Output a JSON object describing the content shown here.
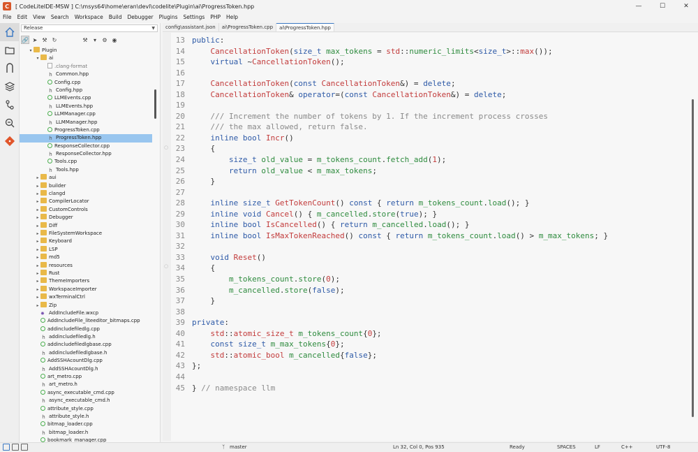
{
  "window": {
    "title": "[ CodeLiteIDE-MSW ] C:\\msys64\\home\\eran\\devl\\codelite\\Plugin\\ai\\ProgressToken.hpp",
    "app_icon_letter": "C",
    "controls": [
      "—",
      "☐",
      "✕"
    ]
  },
  "menu": [
    "File",
    "Edit",
    "View",
    "Search",
    "Workspace",
    "Build",
    "Debugger",
    "Plugins",
    "Settings",
    "PHP",
    "Help"
  ],
  "activity_bar": [
    "home-icon",
    "folder-icon",
    "magnet-icon",
    "layers-icon",
    "source-control-icon",
    "search-icon",
    "git-icon"
  ],
  "sidebar": {
    "config": "Release",
    "tree": [
      {
        "label": "Plugin",
        "type": "folder",
        "depth": 1,
        "open": true
      },
      {
        "label": "ai",
        "type": "folder",
        "depth": 2,
        "open": true
      },
      {
        "label": ".clang-format",
        "type": "file",
        "depth": 3,
        "dim": true
      },
      {
        "label": "Common.hpp",
        "type": "h",
        "depth": 3
      },
      {
        "label": "Config.cpp",
        "type": "cpp",
        "depth": 3
      },
      {
        "label": "Config.hpp",
        "type": "h",
        "depth": 3
      },
      {
        "label": "LLMEvents.cpp",
        "type": "cpp",
        "depth": 3
      },
      {
        "label": "LLMEvents.hpp",
        "type": "h",
        "depth": 3
      },
      {
        "label": "LLMManager.cpp",
        "type": "cpp",
        "depth": 3
      },
      {
        "label": "LLMManager.hpp",
        "type": "h",
        "depth": 3
      },
      {
        "label": "ProgressToken.cpp",
        "type": "cpp",
        "depth": 3
      },
      {
        "label": "ProgressToken.hpp",
        "type": "h",
        "depth": 3,
        "selected": true
      },
      {
        "label": "ResponseCollector.cpp",
        "type": "cpp",
        "depth": 3
      },
      {
        "label": "ResponseCollector.hpp",
        "type": "h",
        "depth": 3
      },
      {
        "label": "Tools.cpp",
        "type": "cpp",
        "depth": 3
      },
      {
        "label": "Tools.hpp",
        "type": "h",
        "depth": 3
      },
      {
        "label": "aui",
        "type": "folder",
        "depth": 2
      },
      {
        "label": "builder",
        "type": "folder",
        "depth": 2
      },
      {
        "label": "clangd",
        "type": "folder",
        "depth": 2
      },
      {
        "label": "CompilerLocator",
        "type": "folder",
        "depth": 2
      },
      {
        "label": "CustomControls",
        "type": "folder",
        "depth": 2
      },
      {
        "label": "Debugger",
        "type": "folder",
        "depth": 2
      },
      {
        "label": "Diff",
        "type": "folder",
        "depth": 2
      },
      {
        "label": "FileSystemWorkspace",
        "type": "folder",
        "depth": 2
      },
      {
        "label": "Keyboard",
        "type": "folder",
        "depth": 2
      },
      {
        "label": "LSP",
        "type": "folder",
        "depth": 2
      },
      {
        "label": "md5",
        "type": "folder",
        "depth": 2
      },
      {
        "label": "resources",
        "type": "folder",
        "depth": 2
      },
      {
        "label": "Rust",
        "type": "folder",
        "depth": 2
      },
      {
        "label": "ThemeImporters",
        "type": "folder",
        "depth": 2
      },
      {
        "label": "WorkspaceImporter",
        "type": "folder",
        "depth": 2
      },
      {
        "label": "wxTerminalCtrl",
        "type": "folder",
        "depth": 2
      },
      {
        "label": "Zip",
        "type": "folder",
        "depth": 2
      },
      {
        "label": "AddIncludeFile.wxcp",
        "type": "xcp",
        "depth": 2
      },
      {
        "label": "AddIncludeFile_liteeditor_bitmaps.cpp",
        "type": "cpp",
        "depth": 2
      },
      {
        "label": "addincludefiledlg.cpp",
        "type": "cpp",
        "depth": 2
      },
      {
        "label": "addincludefiledlg.h",
        "type": "h",
        "depth": 2
      },
      {
        "label": "addincludefiledlgbase.cpp",
        "type": "cpp",
        "depth": 2
      },
      {
        "label": "addincludefiledlgbase.h",
        "type": "h",
        "depth": 2
      },
      {
        "label": "AddSSHAcountDlg.cpp",
        "type": "cpp",
        "depth": 2
      },
      {
        "label": "AddSSHAcountDlg.h",
        "type": "h",
        "depth": 2
      },
      {
        "label": "art_metro.cpp",
        "type": "cpp",
        "depth": 2
      },
      {
        "label": "art_metro.h",
        "type": "h",
        "depth": 2
      },
      {
        "label": "async_executable_cmd.cpp",
        "type": "cpp",
        "depth": 2
      },
      {
        "label": "async_executable_cmd.h",
        "type": "h",
        "depth": 2
      },
      {
        "label": "attribute_style.cpp",
        "type": "cpp",
        "depth": 2
      },
      {
        "label": "attribute_style.h",
        "type": "h",
        "depth": 2
      },
      {
        "label": "bitmap_loader.cpp",
        "type": "cpp",
        "depth": 2
      },
      {
        "label": "bitmap_loader.h",
        "type": "h",
        "depth": 2
      },
      {
        "label": "bookmark_manager.cpp",
        "type": "cpp",
        "depth": 2
      }
    ]
  },
  "tabs": [
    {
      "label": "config\\assistant.json",
      "active": false
    },
    {
      "label": "ai\\ProgressToken.cpp",
      "active": false
    },
    {
      "label": "ai\\ProgressToken.hpp",
      "active": true
    }
  ],
  "code": [
    {
      "n": "13",
      "t": "public:"
    },
    {
      "n": "14",
      "t": "    CancellationToken(size_t max_tokens = std::numeric_limits<size_t>::max());"
    },
    {
      "n": "15",
      "t": "    virtual ~CancellationToken();"
    },
    {
      "n": "16",
      "t": ""
    },
    {
      "n": "17",
      "t": "    CancellationToken(const CancellationToken&) = delete;"
    },
    {
      "n": "18",
      "t": "    CancellationToken& operator=(const CancellationToken&) = delete;"
    },
    {
      "n": "19",
      "t": ""
    },
    {
      "n": "20",
      "t": "    /// Increment the number of tokens by 1. If the increment process crosses"
    },
    {
      "n": "21",
      "t": "    /// the max allowed, return false."
    },
    {
      "n": "22",
      "t": "    inline bool Incr()"
    },
    {
      "n": "23",
      "t": "    {"
    },
    {
      "n": "24",
      "t": "        size_t old_value = m_tokens_count.fetch_add(1);"
    },
    {
      "n": "25",
      "t": "        return old_value < m_max_tokens;"
    },
    {
      "n": "26",
      "t": "    }"
    },
    {
      "n": "27",
      "t": ""
    },
    {
      "n": "28",
      "t": "    inline size_t GetTokenCount() const { return m_tokens_count.load(); }"
    },
    {
      "n": "29",
      "t": "    inline void Cancel() { m_cancelled.store(true); }"
    },
    {
      "n": "30",
      "t": "    inline bool IsCancelled() { return m_cancelled.load(); }"
    },
    {
      "n": "31",
      "t": "    inline bool IsMaxTokenReached() const { return m_tokens_count.load() > m_max_tokens; }"
    },
    {
      "n": "32",
      "t": ""
    },
    {
      "n": "33",
      "t": "    void Reset()"
    },
    {
      "n": "34",
      "t": "    {"
    },
    {
      "n": "35",
      "t": "        m_tokens_count.store(0);"
    },
    {
      "n": "36",
      "t": "        m_cancelled.store(false);"
    },
    {
      "n": "37",
      "t": "    }"
    },
    {
      "n": "38",
      "t": ""
    },
    {
      "n": "39",
      "t": "private:"
    },
    {
      "n": "40",
      "t": "    std::atomic_size_t m_tokens_count{0};"
    },
    {
      "n": "41",
      "t": "    const size_t m_max_tokens{0};"
    },
    {
      "n": "42",
      "t": "    std::atomic_bool m_cancelled{false};"
    },
    {
      "n": "43",
      "t": "};"
    },
    {
      "n": "44",
      "t": ""
    },
    {
      "n": "45",
      "t": "} // namespace llm"
    }
  ],
  "status": {
    "branch": "master",
    "position": "Ln 32, Col 0, Pos 935",
    "state": "Ready",
    "indent": "SPACES",
    "eol": "LF",
    "language": "C++",
    "encoding": "UTF-8"
  },
  "colors": {
    "keyword": "#2e5aa7",
    "function": "#c23b3b",
    "comment": "#8a8a8a",
    "member": "#2e8b3e",
    "selection": "#99c6ef"
  }
}
